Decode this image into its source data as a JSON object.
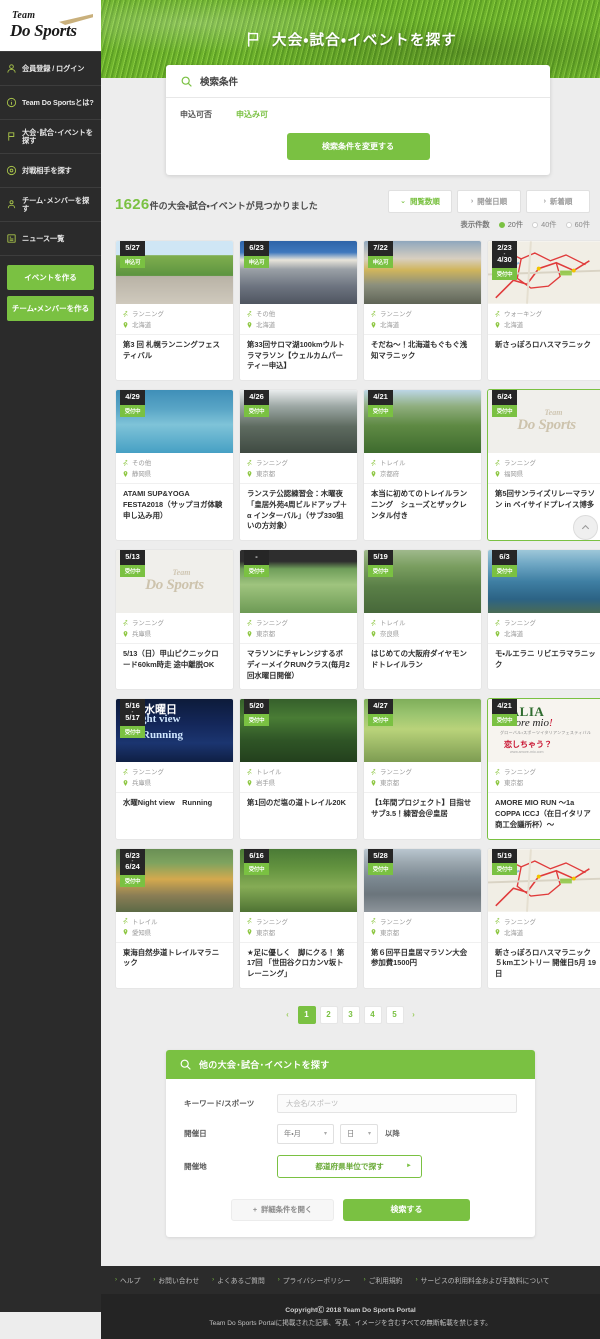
{
  "sidebar": {
    "logo": {
      "line1": "Team",
      "line2": "Do Sports"
    },
    "items": [
      {
        "label": "会員登録 / ログイン",
        "icon": "user-icon"
      },
      {
        "label": "Team Do Sportsとは?",
        "icon": "info-icon"
      },
      {
        "label": "大会･試合･イベントを探す",
        "icon": "flag-icon"
      },
      {
        "label": "対戦相手を探す",
        "icon": "target-icon"
      },
      {
        "label": "チーム･メンバーを探す",
        "icon": "people-icon"
      },
      {
        "label": "ニュース一覧",
        "icon": "news-icon"
      }
    ],
    "buttons": [
      {
        "label": "イベントを作る"
      },
      {
        "label": "チーム・メンバーを作る"
      }
    ]
  },
  "hero": {
    "title": "大会・試合・イベントを探す",
    "icon": "flag-icon"
  },
  "search_condition": {
    "heading": "検索条件",
    "heading_icon": "search-icon",
    "rows": [
      {
        "key": "申込可否",
        "value": "申込み可"
      }
    ],
    "change_button": "検索条件を変更する"
  },
  "results": {
    "count": "1626",
    "count_unit": "件",
    "count_suffix": "の大会・試合・イベントが見つかりました",
    "sort_buttons": [
      {
        "label": "閲覧数順",
        "active": true,
        "caret": "⌄"
      },
      {
        "label": "開催日順",
        "active": false,
        "caret": "›"
      },
      {
        "label": "新着順",
        "active": false,
        "caret": "›"
      }
    ],
    "per_page_label": "表示件数",
    "per_page_options": [
      {
        "label": "20件",
        "selected": true
      },
      {
        "label": "40件",
        "selected": false
      },
      {
        "label": "60件",
        "selected": false
      }
    ]
  },
  "cards": [
    {
      "date": "5/27",
      "date2": "",
      "status": "申込可",
      "category": "ランニング",
      "location": "北海道",
      "title": "第3 回 札幌ランニングフェスティバル",
      "img": "photo-runners-hill",
      "highlight": false
    },
    {
      "date": "6/23",
      "date2": "",
      "status": "申込可",
      "category": "その他",
      "location": "北海道",
      "title": "第33回サロマ湖100kmウルトラマラソン【ウェルカムパーティー申込】",
      "img": "photo-garmin-start",
      "highlight": false
    },
    {
      "date": "7/22",
      "date2": "",
      "status": "申込可",
      "category": "ランニング",
      "location": "北海道",
      "title": "そだね～！北海道もぐもぐ浅知マラニック",
      "img": "photo-race-banner",
      "highlight": false
    },
    {
      "date": "2/23",
      "date2": "4/30",
      "status": "受付中",
      "category": "ウォーキング",
      "location": "北海道",
      "title": "新さっぽろロハスマラニック",
      "img": "map-course-red",
      "highlight": false
    },
    {
      "date": "4/29",
      "date2": "",
      "status": "受付中",
      "category": "その他",
      "location": "静岡県",
      "title": "ATAMI SUP&YOGA FESTA2018（サップヨガ体験申し込み用）",
      "img": "photo-sup-yoga",
      "highlight": false
    },
    {
      "date": "4/26",
      "date2": "",
      "status": "受付中",
      "category": "ランニング",
      "location": "東京都",
      "title": "ランステ公認練習会：木曜夜「皇居外苑4周ビルドアップ＋α インターバル」（サブ330狙いの方対象）",
      "img": "photo-group-indoor",
      "highlight": false
    },
    {
      "date": "4/21",
      "date2": "",
      "status": "受付中",
      "category": "トレイル",
      "location": "京都府",
      "title": "本当に初めてのトレイルランニング　シューズとザックレンタル付き",
      "img": "photo-trail-summit",
      "highlight": false
    },
    {
      "date": "6/24",
      "date2": "",
      "status": "受付中",
      "category": "ランニング",
      "location": "福岡県",
      "title": "第5回サンライズリレーマラソン in ベイサイドプレイス博多",
      "img": "placeholder-logo",
      "highlight": true
    },
    {
      "date": "5/13",
      "date2": "",
      "status": "受付中",
      "category": "ランニング",
      "location": "兵庫県",
      "title": "5/13（日）甲山ピクニックロード60km時走 途中離脱OK",
      "img": "placeholder-logo",
      "highlight": false
    },
    {
      "date": "-",
      "date2": "",
      "status": "受付中",
      "category": "ランニング",
      "location": "東京都",
      "title": "マラソンにチャレンジするボディーメイクRUNクラス(毎月2回水曜日開催）",
      "img": "photo-river-runner",
      "highlight": false
    },
    {
      "date": "5/19",
      "date2": "",
      "status": "受付中",
      "category": "トレイル",
      "location": "奈良県",
      "title": "はじめての大阪府ダイヤモンドトレイルラン",
      "img": "photo-group-mountain",
      "highlight": false
    },
    {
      "date": "6/3",
      "date2": "",
      "status": "受付中",
      "category": "ランニング",
      "location": "北海道",
      "title": "モ・ルエラニ リビエラマラニック",
      "img": "photo-coast-cliff",
      "highlight": false
    },
    {
      "date": "5/16",
      "date2": "5/17",
      "status": "受付中",
      "category": "ランニング",
      "location": "兵庫県",
      "title": "水曜Night view　Running",
      "img": "photo-night-view",
      "highlight": false
    },
    {
      "date": "5/20",
      "date2": "",
      "status": "受付中",
      "category": "トレイル",
      "location": "岩手県",
      "title": "第1回のだ塩の道トレイル20K",
      "img": "photo-forest-trail",
      "highlight": false
    },
    {
      "date": "4/27",
      "date2": "",
      "status": "受付中",
      "category": "ランニング",
      "location": "東京都",
      "title": "【1年間プロジェクト】目指せサブ3.5！練習会＠皇居",
      "img": "photo-three-runners",
      "highlight": false
    },
    {
      "date": "4/21",
      "date2": "",
      "status": "受付中",
      "category": "ランニング",
      "location": "東京都",
      "title": "AMORE MIO RUN ～1a COPPA ICCJ（在日イタリア商工会議所杯）～",
      "img": "poster-italia",
      "highlight": true
    },
    {
      "date": "6/23",
      "date2": "6/24",
      "status": "受付中",
      "category": "トレイル",
      "location": "愛知県",
      "title": "東海自然歩道トレイルマラニック",
      "img": "photo-aid-station",
      "highlight": false
    },
    {
      "date": "6/16",
      "date2": "",
      "status": "受付中",
      "category": "ランニング",
      "location": "東京都",
      "title": "★足に優しく　脚にクる！ 第17回 「世田谷クロカンV坂トレーニング」",
      "img": "photo-forest-runners",
      "highlight": false
    },
    {
      "date": "5/28",
      "date2": "",
      "status": "受付中",
      "category": "ランニング",
      "location": "東京都",
      "title": "第６回平日皇居マラソン大会 参加費1500円",
      "img": "photo-group-gate",
      "highlight": false
    },
    {
      "date": "5/19",
      "date2": "",
      "status": "受付中",
      "category": "ランニング",
      "location": "北海道",
      "title": "新さっぽろロハスマラニック５kmエントリー 開催日5月 19日",
      "img": "map-course-red",
      "highlight": false
    }
  ],
  "pagination": {
    "prev": "‹",
    "next": "›",
    "pages": [
      "1",
      "2",
      "3",
      "4",
      "5"
    ],
    "current": "1"
  },
  "bottom_search": {
    "heading": "他の大会･試合･イベントを探す",
    "heading_icon": "search-icon",
    "keyword": {
      "label": "キーワード/スポーツ",
      "placeholder": "大会名/スポーツ",
      "value": ""
    },
    "date": {
      "label": "開催日",
      "year_month": "年・月",
      "day": "日",
      "suffix": "以降"
    },
    "place": {
      "label": "開催地",
      "button": "都道府県単位で探す",
      "caret": "►"
    },
    "advanced_button": "詳細条件を開く",
    "advanced_icon": "+",
    "submit_button": "検索する"
  },
  "footer": {
    "links": [
      "ヘルプ",
      "お問い合わせ",
      "よくあるご質問",
      "プライバシーポリシー",
      "ご利用規約",
      "サービスの利用料金および手数料について"
    ],
    "copyright": "CopyrightⒸ 2018 Team Do Sports Portal",
    "notice": "Team Do Sports Portalに掲載された記事、写真、イメージを含むすべての無断転載を禁じます。"
  },
  "scroll_top": {
    "icon": "chevron-up-icon"
  },
  "colors": {
    "accent": "#7ac142",
    "dark": "#2b2b2b",
    "badge_dark": "#262626"
  }
}
